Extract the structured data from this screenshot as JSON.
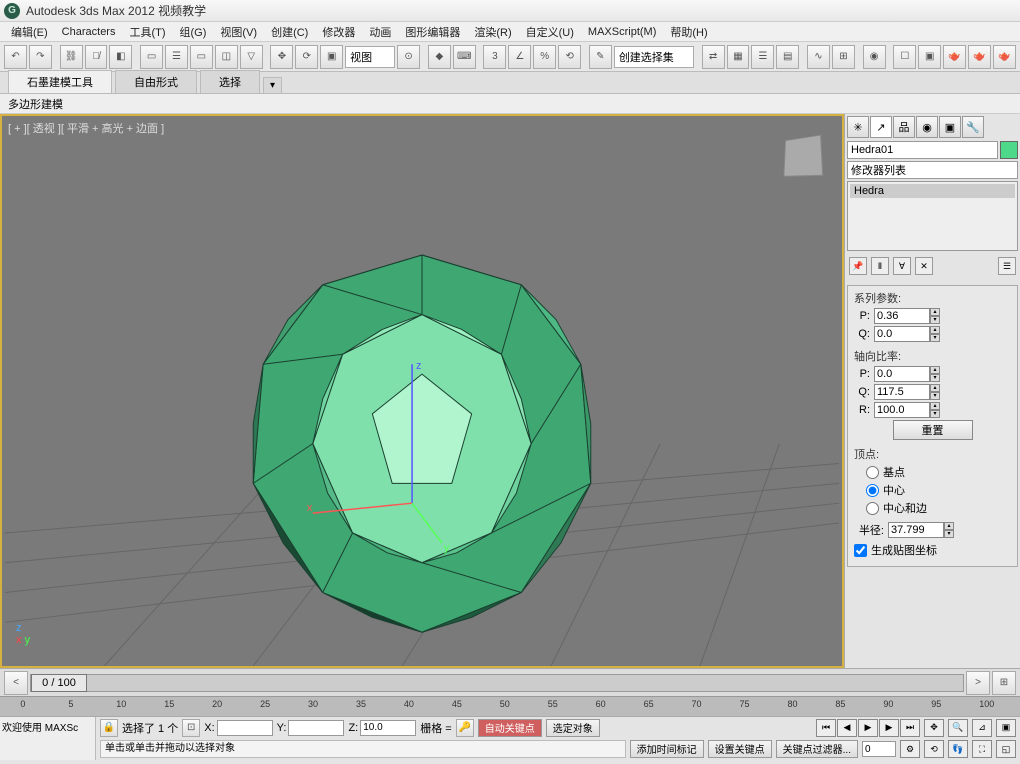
{
  "title": "Autodesk 3ds Max 2012  视频教学",
  "menus": [
    "编辑(E)",
    "Characters",
    "工具(T)",
    "组(G)",
    "视图(V)",
    "创建(C)",
    "修改器",
    "动画",
    "图形编辑器",
    "渲染(R)",
    "自定义(U)",
    "MAXScript(M)",
    "帮助(H)"
  ],
  "toolbar_combo": "视图",
  "selection_set_placeholder": "创建选择集",
  "ribbon": {
    "tabs": [
      "石墨建模工具",
      "自由形式",
      "选择"
    ],
    "sub": "多边形建模"
  },
  "viewport_label": "[ + ][ 透视 ][ 平滑 + 高光 + 边面 ]",
  "axes": {
    "x": "x",
    "y": "y",
    "z": "z"
  },
  "object_name": "Hedra01",
  "modifier_list_label": "修改器列表",
  "modifier_stack_item": "Hedra",
  "params": {
    "series_label": "系列参数:",
    "p_label": "P:",
    "p_value": "0.36",
    "q_label": "Q:",
    "q_value": "0.0",
    "axis_ratio_label": "轴向比率:",
    "ap_label": "P:",
    "ap_value": "0.0",
    "aq_label": "Q:",
    "aq_value": "117.5",
    "ar_label": "R:",
    "ar_value": "100.0",
    "reset": "重置",
    "vertex_label": "顶点:",
    "radio_base": "基点",
    "radio_center": "中心",
    "radio_center_edge": "中心和边",
    "radius_label": "半径:",
    "radius_value": "37.799",
    "gen_map": "生成贴图坐标"
  },
  "timeline": {
    "slider_text": "0 / 100",
    "ticks": [
      "0",
      "5",
      "10",
      "15",
      "20",
      "25",
      "30",
      "35",
      "40",
      "45",
      "50",
      "55",
      "60",
      "65",
      "70",
      "75",
      "80",
      "85",
      "90",
      "95",
      "100"
    ]
  },
  "status": {
    "welcome": "欢迎使用  MAXSc",
    "selected": "选择了 1  个",
    "x_label": "X:",
    "y_label": "Y:",
    "z_label": "Z:",
    "z_value": "10.0",
    "grid_label": "栅格 =",
    "auto_key": "自动关键点",
    "selected_obj": "选定对象",
    "set_key": "设置关键点",
    "key_filter": "关键点过滤器...",
    "prompt": "单击或单击并拖动以选择对象",
    "add_time_tag": "添加时间标记"
  }
}
